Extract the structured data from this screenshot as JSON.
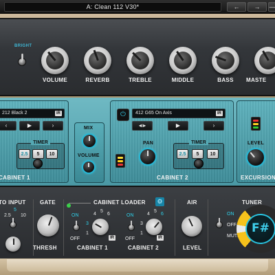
{
  "topbar": {
    "preset_name": "A: Clean 112 V30*",
    "prev_label": "←",
    "next_label": "→",
    "save_label": "—"
  },
  "amp": {
    "bright_label": "BRIGHT",
    "knobs": [
      "VOLUME",
      "REVERB",
      "TREBLE",
      "MIDDLE",
      "BASS",
      "MASTE"
    ]
  },
  "cabinet1": {
    "ir_name": "212 Black 2",
    "ir_badge": "IR",
    "nav": [
      "‹",
      "▶",
      "›"
    ],
    "timer_label": "TIMER",
    "timer_options": [
      "2.5",
      "5",
      "10"
    ],
    "timer_selected": "2.5",
    "title": "CABINET 1"
  },
  "mix": {
    "mix_label": "MIX",
    "volume_label": "VOLUME"
  },
  "cabinet2": {
    "ir_name": "412 G65 On Axis",
    "ir_badge": "IR",
    "nav": [
      "◂ı▸",
      "▶",
      "›"
    ],
    "pan_label": "PAN",
    "timer_label": "TIMER",
    "timer_options": [
      "2.5",
      "5",
      "10"
    ],
    "timer_selected": "2.5",
    "title": "CABINET 2",
    "power_icon": "⏻"
  },
  "excursion": {
    "level_label": "LEVEL",
    "title": "EXCURSION"
  },
  "bottom": {
    "auto_input_label": "TO INPUT",
    "auto_input_nums": [
      "5",
      "2.5",
      "10"
    ],
    "gate_label": "GATE",
    "thresh_label": "THRESH",
    "loader_label": "CABINET LOADER",
    "loader_cab1": {
      "on": "ON",
      "off": "OFF",
      "nums": [
        "4",
        "5",
        "6",
        "3",
        "1",
        "2"
      ],
      "label": "CABINET 1",
      "ir": "IR"
    },
    "loader_cab2": {
      "on": "ON",
      "off": "OFF",
      "nums": [
        "4",
        "5",
        "6",
        "3",
        "1",
        "2"
      ],
      "label": "CABINET 2",
      "ir": "IR"
    },
    "air_label": "AIR",
    "level_label": "LEVEL",
    "tuner_label": "TUNER",
    "tuner_on": "ON",
    "tuner_off": "OFF",
    "tuner_mute": "MUTE",
    "tuner_note": "F#"
  },
  "colors": {
    "accent_cyan": "#26b6d4",
    "panel_teal": "#4f9fab",
    "tuner_yellow": "#f6c21c"
  }
}
